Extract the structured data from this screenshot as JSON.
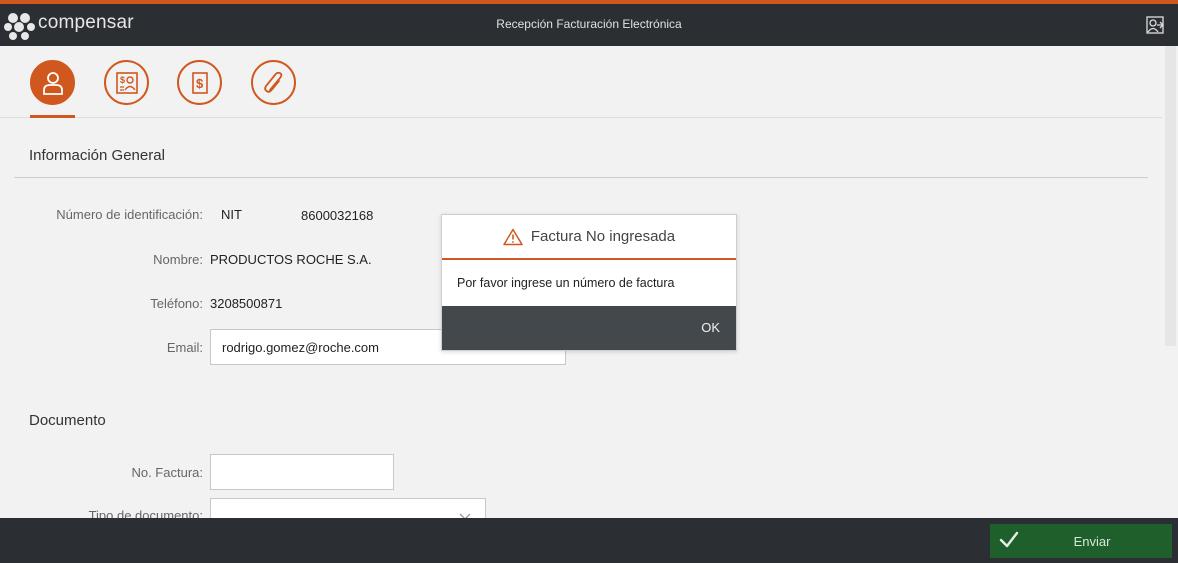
{
  "header": {
    "brand": "compensar",
    "title": "Recepción Facturación Electrónica",
    "exit_icon": "exit-icon"
  },
  "colors": {
    "accent": "#d0581e",
    "header_bg": "#2b2f33",
    "send_green": "#1e5f2b"
  },
  "steps": [
    {
      "icon": "person-icon",
      "active": true
    },
    {
      "icon": "money-user-icon",
      "active": false
    },
    {
      "icon": "invoice-dollar-icon",
      "active": false
    },
    {
      "icon": "paperclip-icon",
      "active": false
    }
  ],
  "general": {
    "section_title": "Información General",
    "id_label": "Número de identificación:",
    "id_type": "NIT",
    "id_number": "8600032168",
    "name_label": "Nombre:",
    "name_value": "PRODUCTOS ROCHE S.A.",
    "phone_label": "Teléfono:",
    "phone_value": "3208500871",
    "email_label": "Email:",
    "email_value": "rodrigo.gomez@roche.com"
  },
  "document": {
    "section_title": "Documento",
    "invoice_label": "No. Factura:",
    "invoice_value": "",
    "doc_type_label": "Tipo de documento:",
    "doc_type_value": ""
  },
  "footer": {
    "send_label": "Enviar"
  },
  "modal": {
    "icon": "warning-icon",
    "title": "Factura No ingresada",
    "message": "Por favor ingrese un número de factura",
    "ok_label": "OK"
  }
}
